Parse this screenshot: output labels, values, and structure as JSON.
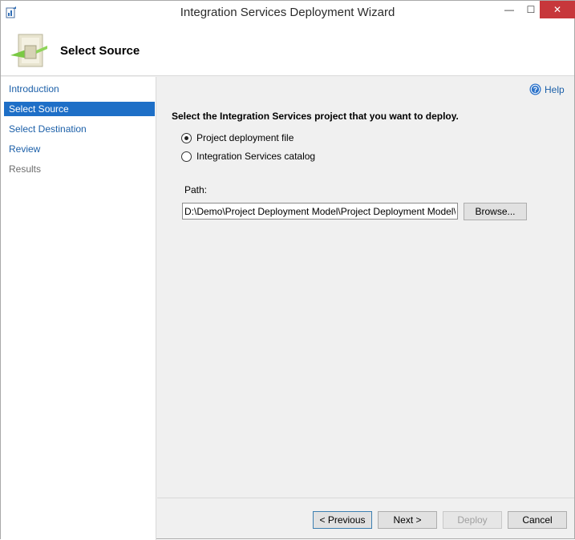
{
  "window": {
    "title": "Integration Services Deployment Wizard",
    "minimize": "—",
    "maximize": "☐",
    "close": "✕"
  },
  "header": {
    "title": "Select Source"
  },
  "nav": {
    "items": [
      {
        "label": "Introduction",
        "state": "normal"
      },
      {
        "label": "Select Source",
        "state": "active"
      },
      {
        "label": "Select Destination",
        "state": "normal"
      },
      {
        "label": "Review",
        "state": "normal"
      },
      {
        "label": "Results",
        "state": "disabled"
      }
    ]
  },
  "main": {
    "help_label": "Help",
    "instruction": "Select the Integration Services project that you want to deploy.",
    "options": [
      {
        "label": "Project deployment file",
        "checked": true
      },
      {
        "label": "Integration Services catalog",
        "checked": false
      }
    ],
    "path_label": "Path:",
    "path_value": "D:\\Demo\\Project Deployment Model\\Project Deployment Model\\bin\\De",
    "browse_label": "Browse..."
  },
  "footer": {
    "previous_label": "< Previous",
    "next_label": "Next >",
    "deploy_label": "Deploy",
    "cancel_label": "Cancel"
  },
  "colors": {
    "accent": "#1e6fc7",
    "link": "#1b5fa8",
    "close": "#c7373b"
  }
}
